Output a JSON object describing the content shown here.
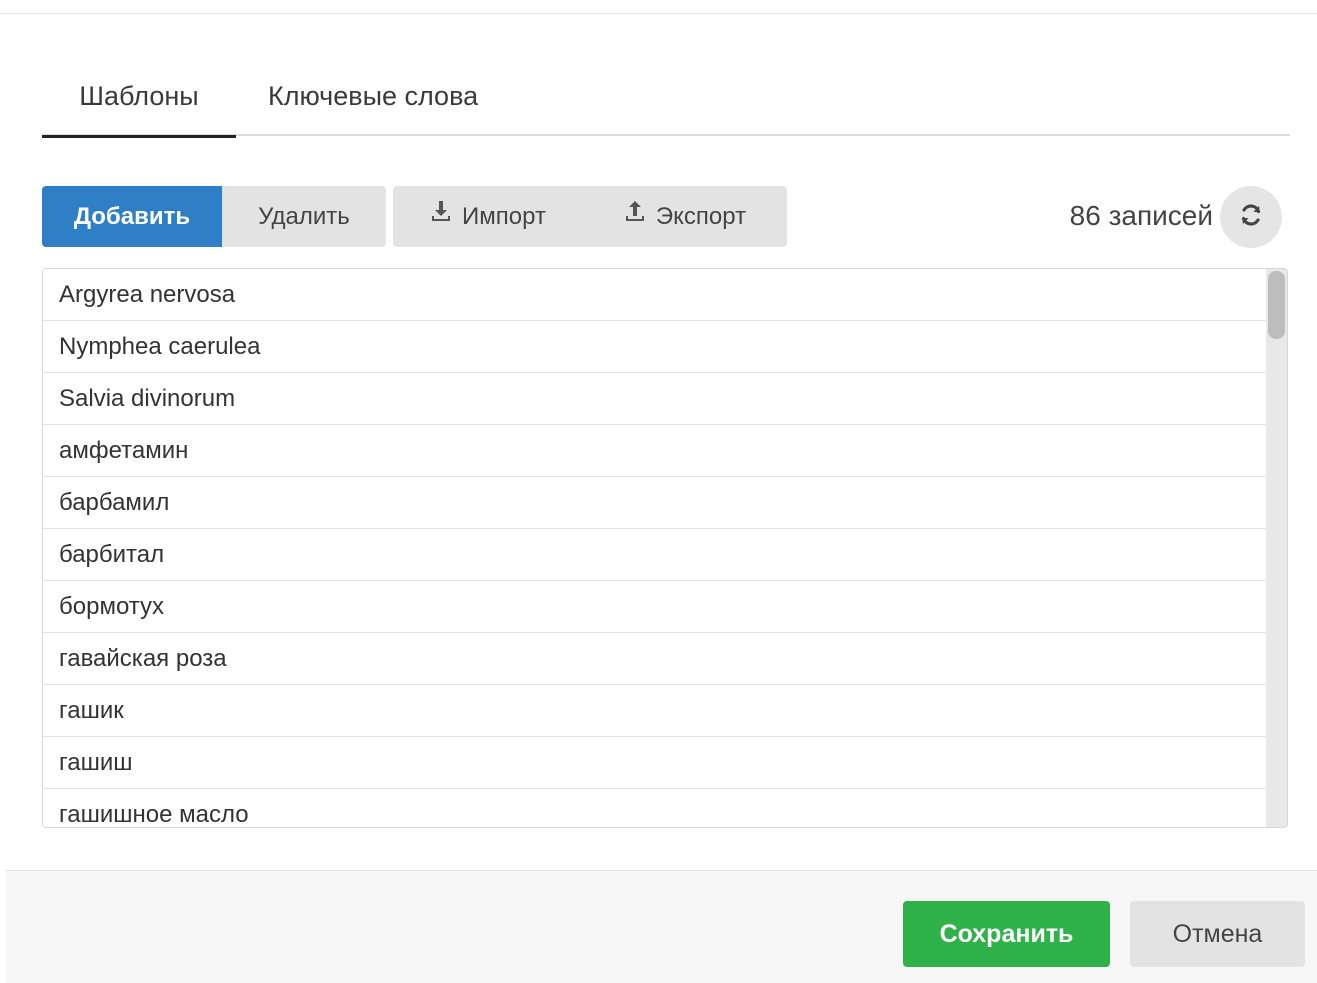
{
  "tabs": [
    {
      "label": "Шаблоны",
      "active": true
    },
    {
      "label": "Ключевые слова",
      "active": false
    }
  ],
  "toolbar": {
    "add_label": "Добавить",
    "delete_label": "Удалить",
    "import_label": "Импорт",
    "import_icon": "download-icon",
    "export_label": "Экспорт",
    "export_icon": "upload-icon",
    "count_label": "86 записей",
    "refresh_icon": "refresh-icon"
  },
  "list": {
    "items": [
      "Argyrea nervosa",
      "Nymphea caerulea",
      "Salvia divinorum",
      "амфетамин",
      "барбамил",
      "барбитал",
      "бормотух",
      "гавайская роза",
      "гашик",
      "гашиш",
      "гашишное масло"
    ]
  },
  "footer": {
    "save_label": "Сохранить",
    "cancel_label": "Отмена"
  },
  "colors": {
    "primary": "#2f7fc6",
    "success": "#2fb24a",
    "neutral_button": "#e3e3e3"
  }
}
